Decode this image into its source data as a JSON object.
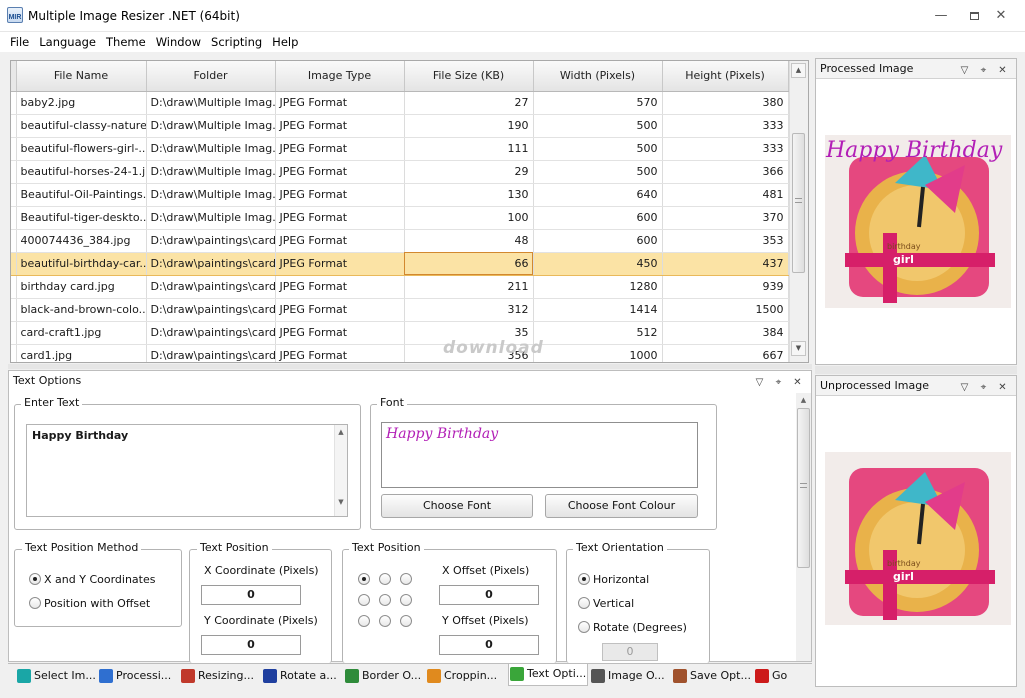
{
  "window": {
    "title": "Multiple Image Resizer .NET (64bit)",
    "icon_text": "MIR",
    "controls": [
      "minimize-icon",
      "restore-icon",
      "close-icon"
    ]
  },
  "menu": [
    "File",
    "Language",
    "Theme",
    "Window",
    "Scripting",
    "Help"
  ],
  "grid": {
    "columns": [
      "File Name",
      "Folder",
      "Image Type",
      "File Size (KB)",
      "Width (Pixels)",
      "Height (Pixels)"
    ],
    "rows": [
      [
        "baby2.jpg",
        "D:\\draw\\Multiple Imag...",
        "JPEG Format",
        "27",
        "570",
        "380"
      ],
      [
        "beautiful-classy-nature...",
        "D:\\draw\\Multiple Imag...",
        "JPEG Format",
        "190",
        "500",
        "333"
      ],
      [
        "beautiful-flowers-girl-...",
        "D:\\draw\\Multiple Imag...",
        "JPEG Format",
        "111",
        "500",
        "333"
      ],
      [
        "beautiful-horses-24-1.j...",
        "D:\\draw\\Multiple Imag...",
        "JPEG Format",
        "29",
        "500",
        "366"
      ],
      [
        "Beautiful-Oil-Paintings...",
        "D:\\draw\\Multiple Imag...",
        "JPEG Format",
        "130",
        "640",
        "481"
      ],
      [
        "Beautiful-tiger-deskto...",
        "D:\\draw\\Multiple Imag...",
        "JPEG Format",
        "100",
        "600",
        "370"
      ],
      [
        "400074436_384.jpg",
        "D:\\draw\\paintings\\cards",
        "JPEG Format",
        "48",
        "600",
        "353"
      ],
      [
        "beautiful-birthday-car...",
        "D:\\draw\\paintings\\cards",
        "JPEG Format",
        "66",
        "450",
        "437"
      ],
      [
        "birthday card.jpg",
        "D:\\draw\\paintings\\cards",
        "JPEG Format",
        "211",
        "1280",
        "939"
      ],
      [
        "black-and-brown-colo...",
        "D:\\draw\\paintings\\cards",
        "JPEG Format",
        "312",
        "1414",
        "1500"
      ],
      [
        "card-craft1.jpg",
        "D:\\draw\\paintings\\cards",
        "JPEG Format",
        "35",
        "512",
        "384"
      ],
      [
        "card1.jpg",
        "D:\\draw\\paintings\\cards",
        "JPEG Format",
        "356",
        "1000",
        "667"
      ]
    ],
    "selected_row_index": 7
  },
  "watermark": "download",
  "processed_panel": {
    "title": "Processed Image"
  },
  "unprocessed_panel": {
    "title": "Unprocessed Image"
  },
  "preview_text": "Happy Birthday",
  "card_text": [
    "birthday",
    "girl"
  ],
  "text_options": {
    "title": "Text Options",
    "enter_text": {
      "label": "Enter Text",
      "value": "Happy Birthday"
    },
    "font": {
      "label": "Font",
      "preview": "Happy Birthday",
      "choose_font": "Choose Font",
      "choose_colour": "Choose Font Colour",
      "colour": "#b21fb6"
    },
    "position_method": {
      "label": "Text Position Method",
      "options": [
        "X and Y Coordinates",
        "Position with Offset"
      ],
      "selected": 0
    },
    "text_position_xy": {
      "label": "Text Position",
      "x_label": "X Coordinate (Pixels)",
      "x_value": "0",
      "y_label": "Y Coordinate (Pixels)",
      "y_value": "0"
    },
    "text_position_offset": {
      "label": "Text Position",
      "x_label": "X Offset (Pixels)",
      "x_value": "0",
      "y_label": "Y Offset (Pixels)",
      "y_value": "0",
      "selected_anchor": 0
    },
    "orientation": {
      "label": "Text Orientation",
      "options": [
        "Horizontal",
        "Vertical",
        "Rotate (Degrees)"
      ],
      "selected": 0,
      "rotate_value": "0"
    }
  },
  "tabs": [
    {
      "label": "Select Im...",
      "icon": "select-images-icon",
      "color": "#1aa6a6"
    },
    {
      "label": "Processi...",
      "icon": "processing-icon",
      "color": "#2f6fd0"
    },
    {
      "label": "Resizing...",
      "icon": "resizing-icon",
      "color": "#c0392b"
    },
    {
      "label": "Rotate a...",
      "icon": "rotate-icon",
      "color": "#1f3f9f"
    },
    {
      "label": "Border O...",
      "icon": "border-icon",
      "color": "#2e8b3a"
    },
    {
      "label": "Croppin...",
      "icon": "cropping-icon",
      "color": "#e08a1e"
    },
    {
      "label": "Text Opti...",
      "icon": "text-options-icon",
      "color": "#3aa63a"
    },
    {
      "label": "Image O...",
      "icon": "image-options-icon",
      "color": "#555555"
    },
    {
      "label": "Save Opt...",
      "icon": "save-options-icon",
      "color": "#a0522d"
    },
    {
      "label": "Go",
      "icon": "go-icon",
      "color": "#cc1a1a"
    }
  ],
  "active_tab": 6,
  "colors": {
    "selection": "#fbe3a5",
    "selection_border": "#d2882f",
    "accent_text": "#b21fb6"
  }
}
